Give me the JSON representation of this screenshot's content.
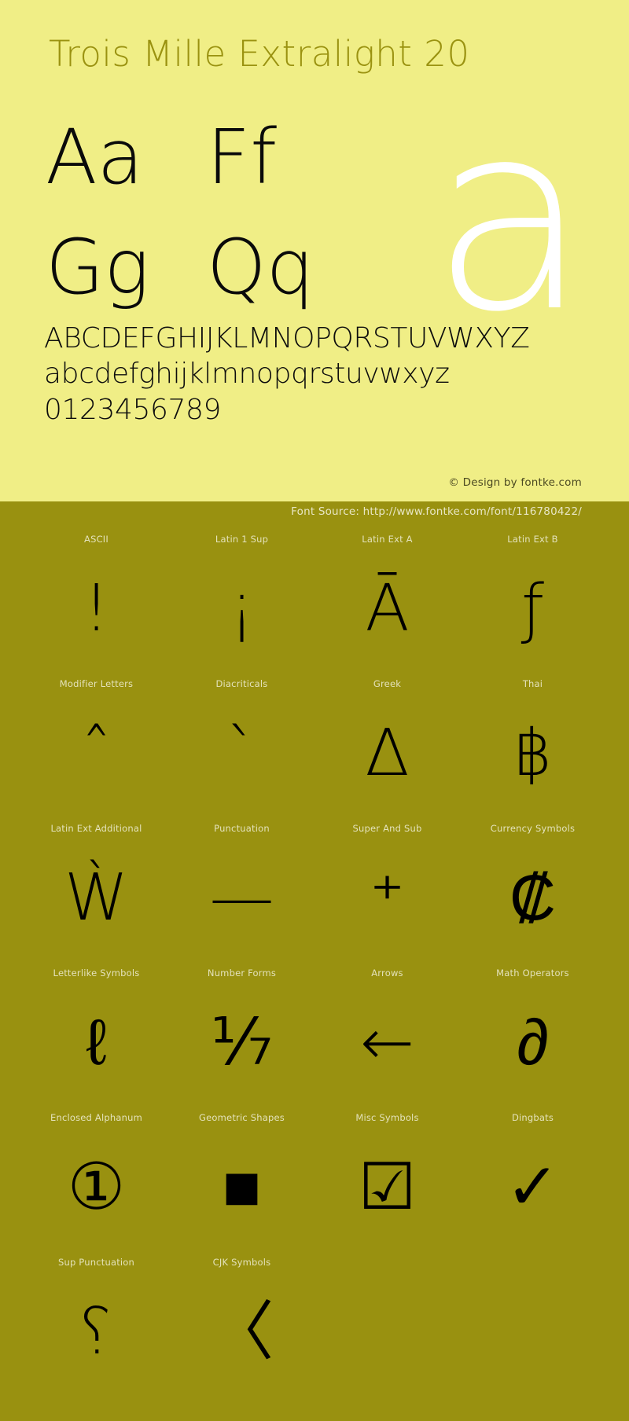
{
  "hero": {
    "title": "Trois Mille Extralight 20",
    "showcase_glyph": "a",
    "pair_rows": [
      {
        "col1": "Aa",
        "col2": "Ff"
      },
      {
        "col1": "Gg",
        "col2": "Qq"
      }
    ],
    "uppercase": "ABCDEFGHIJKLMNOPQRSTUVWXYZ",
    "lowercase": "abcdefghijklmnopqrstuvwxyz",
    "digits": "0123456789",
    "credit": "© Design by fontke.com",
    "background_color": "#f0ee86",
    "title_color": "#9a9210",
    "glyph_color": "#0a0a0a",
    "showcase_color": "#ffffff"
  },
  "source_bar": {
    "text": "Font Source: http://www.fontke.com/font/116780422/",
    "background_color": "#999110",
    "text_color": "#e8e6c4"
  },
  "blocks": {
    "background_color": "#999110",
    "label_color": "#e4e2bb",
    "glyph_color": "#000000",
    "rows": [
      [
        {
          "label": "ASCII",
          "glyph": "!"
        },
        {
          "label": "Latin 1 Sup",
          "glyph": "¡"
        },
        {
          "label": "Latin Ext A",
          "glyph": "Ā"
        },
        {
          "label": "Latin Ext B",
          "glyph": "ƒ"
        }
      ],
      [
        {
          "label": "Modifier Letters",
          "glyph": "ˆ"
        },
        {
          "label": "Diacriticals",
          "glyph": "ˋ"
        },
        {
          "label": "Greek",
          "glyph": "Δ"
        },
        {
          "label": "Thai",
          "glyph": "฿"
        }
      ],
      [
        {
          "label": "Latin Ext Additional",
          "glyph": "Ẁ"
        },
        {
          "label": "Punctuation",
          "glyph": "—"
        },
        {
          "label": "Super And Sub",
          "glyph": "⁺"
        },
        {
          "label": "Currency Symbols",
          "glyph": "₡"
        }
      ],
      [
        {
          "label": "Letterlike Symbols",
          "glyph": "ℓ"
        },
        {
          "label": "Number Forms",
          "glyph": "⅐"
        },
        {
          "label": "Arrows",
          "glyph": "←"
        },
        {
          "label": "Math Operators",
          "glyph": "∂"
        }
      ],
      [
        {
          "label": "Enclosed Alphanum",
          "glyph": "①"
        },
        {
          "label": "Geometric Shapes",
          "glyph": "■"
        },
        {
          "label": "Misc Symbols",
          "glyph": "☑"
        },
        {
          "label": "Dingbats",
          "glyph": "✓"
        }
      ],
      [
        {
          "label": "Sup Punctuation",
          "glyph": "⸮"
        },
        {
          "label": "CJK Symbols",
          "glyph": "〈"
        },
        {
          "label": "",
          "glyph": ""
        },
        {
          "label": "",
          "glyph": ""
        }
      ]
    ]
  }
}
